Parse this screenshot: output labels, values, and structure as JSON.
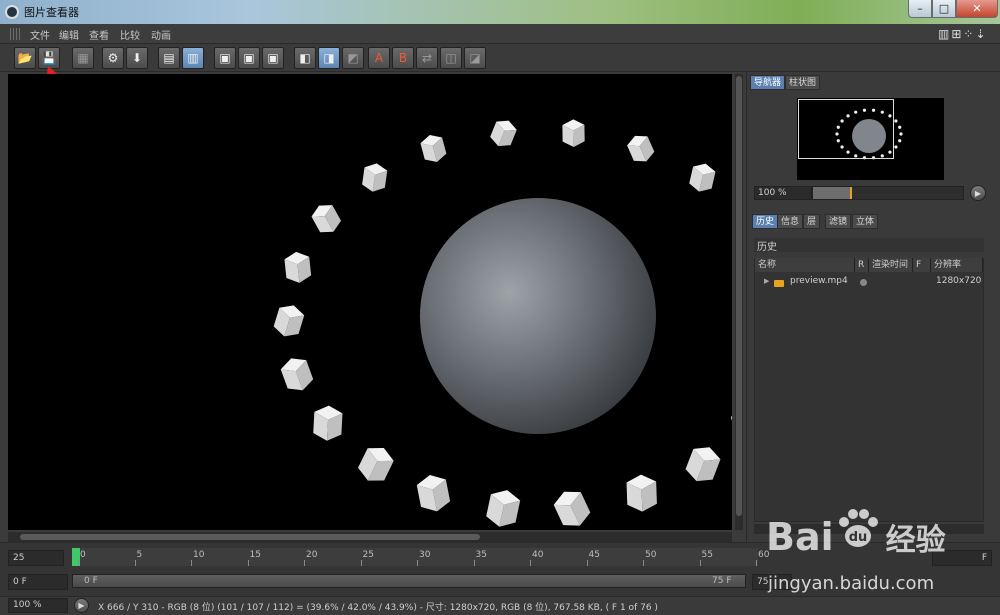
{
  "window": {
    "title": "图片查看器",
    "min": "–",
    "max": "□",
    "close": "✕"
  },
  "menu": {
    "items": [
      "文件",
      "编辑",
      "查看",
      "比较",
      "动画"
    ],
    "right_icons": "▥⊞⁘⇣"
  },
  "toolbar": {
    "icons": [
      "open-icon",
      "save-icon",
      "grid-icon",
      "render-settings-icon",
      "render-region-icon",
      "layers-icon",
      "stack-icon",
      "frame-a-icon",
      "frame-b-icon",
      "frame-c-icon",
      "ab-compare-icon",
      "ab-split-icon",
      "ab-toggle-icon",
      "set-a-icon",
      "set-b-icon",
      "swap-icon",
      "channel-icon",
      "filter-icon"
    ]
  },
  "panel": {
    "top_tabs": [
      "导航器",
      "柱状图"
    ],
    "zoom": "100 %",
    "bottom_tabs": [
      "历史",
      "信息",
      "层",
      "滤镜",
      "立体"
    ],
    "history_title": "历史",
    "columns": [
      "名称",
      "R",
      "渲染时间",
      "F",
      "分辨率"
    ],
    "rows": [
      {
        "name": "preview.mp4",
        "resolution": "1280x720"
      }
    ]
  },
  "timeline": {
    "fps": "25",
    "ruler_labels": [
      "0",
      "5",
      "10",
      "15",
      "20",
      "25",
      "30",
      "35",
      "40",
      "45",
      "50",
      "55",
      "60"
    ],
    "start_field": "0 F",
    "range_start": "0 F",
    "range_end": "75 F",
    "end_field": "75",
    "end_frame_field": "F"
  },
  "status": {
    "zoom": "100 %",
    "text": "X 666 / Y 310 - RGB (8 位) (101 / 107 / 112) = (39.6% / 42.0% / 43.9%) - 尺寸: 1280x720, RGB (8 位), 767.58 KB, ( F 1 of 76 )"
  },
  "watermark": {
    "brand_left": "Bai",
    "brand_right": "经验",
    "paw_text": "du",
    "url": "jingyan.baidu.com"
  },
  "colors": {
    "accent": "#5b7fae",
    "timeline_marker": "#3ec86a",
    "folder": "#e8a31c",
    "annotation_arrow": "#e52020"
  }
}
